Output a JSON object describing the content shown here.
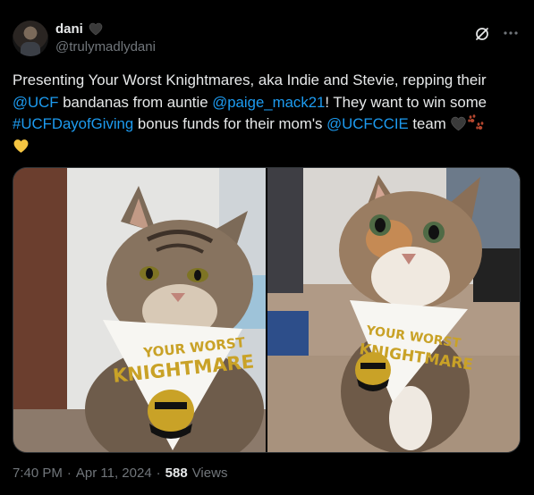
{
  "author": {
    "display_name": "dani",
    "badge_icon": "black-heart-icon",
    "handle": "@trulymadlydani"
  },
  "tweet": {
    "segments": [
      {
        "text": "Presenting Your Worst Knightmares, aka Indie and Stevie, repping their ",
        "link": false
      },
      {
        "text": "@UCF",
        "link": true
      },
      {
        "text": " bandanas from auntie ",
        "link": false
      },
      {
        "text": "@paige_mack21",
        "link": true
      },
      {
        "text": "! They want to win some ",
        "link": false
      },
      {
        "text": "#UCFDayofGiving",
        "link": true
      },
      {
        "text": " bonus funds for their mom's ",
        "link": false
      },
      {
        "text": "@UCFCCIE",
        "link": true
      },
      {
        "text": " team ",
        "link": false
      }
    ],
    "trailing_emojis": [
      "black-heart-icon",
      "paw-prints-icon",
      "yellow-heart-icon"
    ]
  },
  "media": {
    "photos": [
      {
        "bandana_line1": "YOUR WORST",
        "bandana_line2": "KNIGHTMARE"
      },
      {
        "bandana_line1": "YOUR WORST",
        "bandana_line2": "KNIGHTMARE"
      }
    ]
  },
  "meta": {
    "time": "7:40 PM",
    "date": "Apr 11, 2024",
    "separator": "·",
    "views_count": "588",
    "views_label": "Views"
  },
  "colors": {
    "link": "#1d9bf0",
    "secondary_text": "#71767b",
    "background": "#000000",
    "bandana_gold": "#c9a227"
  }
}
